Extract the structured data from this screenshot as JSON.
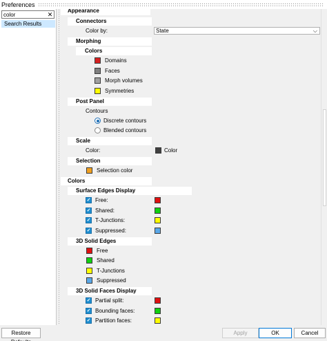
{
  "window": {
    "title": "Preferences"
  },
  "search": {
    "value": "color",
    "clear_glyph": "✕"
  },
  "results": [
    "Search Results"
  ],
  "appearance": {
    "header": "Appearance",
    "connectors": {
      "header": "Connectors",
      "color_by_label": "Color by:",
      "color_by_value": "State"
    },
    "morphing": {
      "header": "Morphing",
      "colors_header": "Colors",
      "items": [
        {
          "label": "Domains",
          "color": "#d62020"
        },
        {
          "label": "Faces",
          "color": "#808080"
        },
        {
          "label": "Morph volumes",
          "color": "#a0a0a0"
        },
        {
          "label": "Symmetries",
          "color": "#ffff00"
        }
      ]
    },
    "post_panel": {
      "header": "Post Panel",
      "contours_label": "Contours",
      "options": [
        {
          "label": "Discrete contours",
          "selected": true
        },
        {
          "label": "Blended contours",
          "selected": false
        }
      ]
    },
    "scale": {
      "header": "Scale",
      "color_label": "Color:",
      "color_value": "Color",
      "color": "#404040"
    },
    "selection": {
      "header": "Selection",
      "label": "Selection color",
      "color": "#f0a020"
    }
  },
  "colors": {
    "header": "Colors",
    "surface_edges": {
      "header": "Surface Edges Display",
      "items": [
        {
          "label": "Free:",
          "checked": true,
          "color": "#e01010"
        },
        {
          "label": "Shared:",
          "checked": true,
          "color": "#10d010"
        },
        {
          "label": "T-Junctions:",
          "checked": true,
          "color": "#ffff00"
        },
        {
          "label": "Suppressed:",
          "checked": true,
          "color": "#5aa8e8"
        }
      ]
    },
    "solid_edges": {
      "header": "3D Solid Edges",
      "items": [
        {
          "label": "Free",
          "color": "#e01010"
        },
        {
          "label": "Shared",
          "color": "#10d010"
        },
        {
          "label": "T-Junctions",
          "color": "#ffff00"
        },
        {
          "label": "Suppressed",
          "color": "#5aa8e8"
        }
      ]
    },
    "solid_faces": {
      "header": "3D Solid Faces Display",
      "items": [
        {
          "label": "Partial split:",
          "checked": true,
          "color": "#e01010"
        },
        {
          "label": "Bounding faces:",
          "checked": true,
          "color": "#10d010"
        },
        {
          "label": "Partition faces:",
          "checked": true,
          "color": "#ffff00"
        }
      ]
    }
  },
  "buttons": {
    "restore": "Restore Defaults",
    "apply": "Apply",
    "ok": "OK",
    "cancel": "Cancel"
  }
}
